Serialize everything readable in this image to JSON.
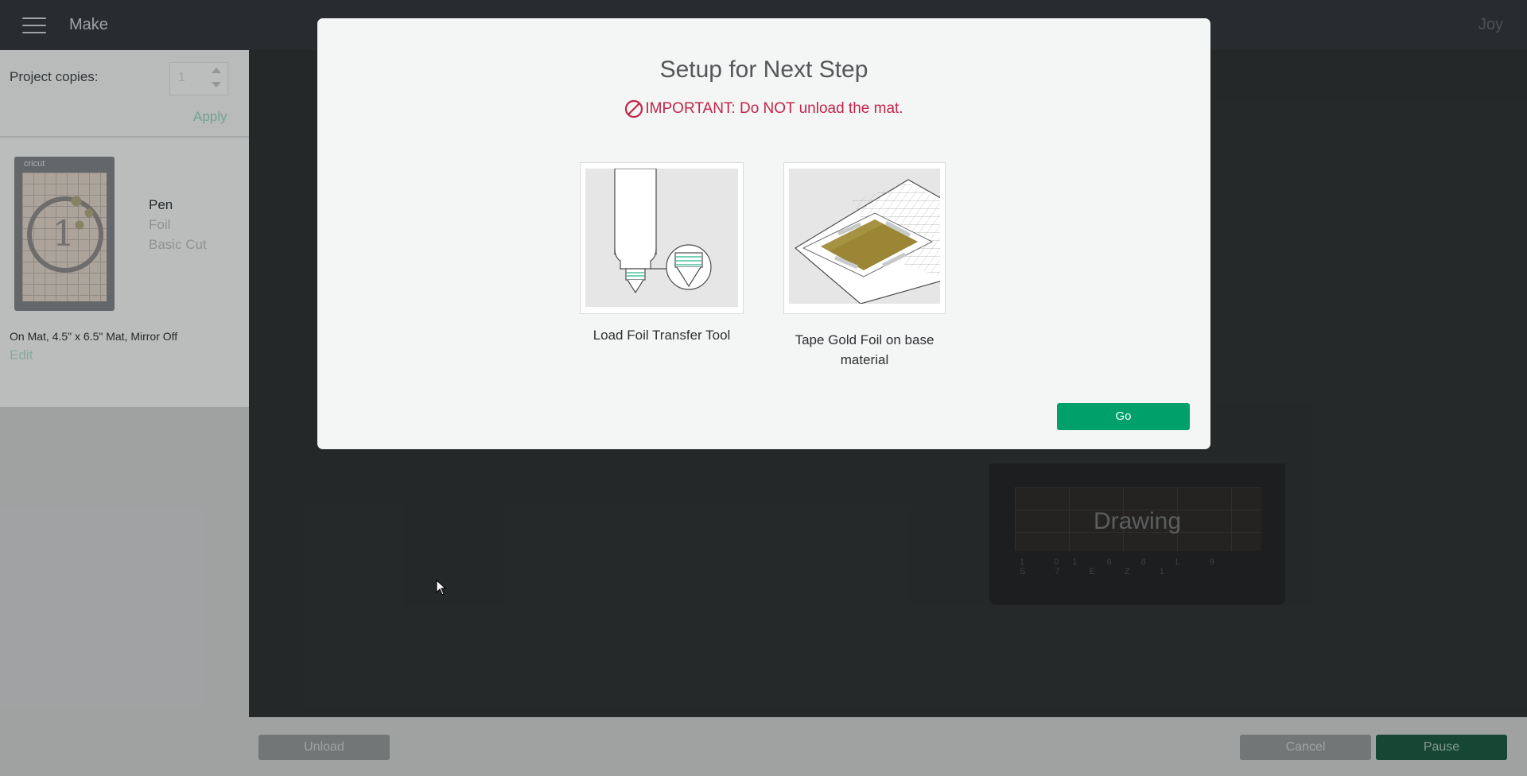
{
  "topbar": {
    "title": "Make",
    "user": "Joy"
  },
  "left_panel": {
    "copies_label": "Project copies:",
    "copies_value": "1",
    "apply_label": "Apply",
    "mat": {
      "brand": "cricut",
      "number": "1",
      "tools": [
        "Pen",
        "Foil",
        "Basic Cut"
      ],
      "info": "On Mat, 4.5\" x 6.5\" Mat, Mirror Off",
      "edit_label": "Edit"
    }
  },
  "background": {
    "mat_label": "Drawing",
    "ruler": "1 01 6 8 L 9 S 7 E Z 1"
  },
  "bottom_bar": {
    "unload_label": "Unload",
    "cancel_label": "Cancel",
    "pause_label": "Pause"
  },
  "modal": {
    "title": "Setup for Next Step",
    "warning": "IMPORTANT: Do NOT unload the mat.",
    "steps": [
      {
        "label": "Load Foil Transfer Tool",
        "icon": "foil-transfer-tool-illustration"
      },
      {
        "label": "Tape Gold Foil on base material",
        "icon": "gold-foil-mat-illustration"
      }
    ],
    "go_label": "Go"
  },
  "colors": {
    "accent_green": "#00a06a",
    "warning_red": "#c2264a",
    "gold_foil": "#9a8634"
  }
}
